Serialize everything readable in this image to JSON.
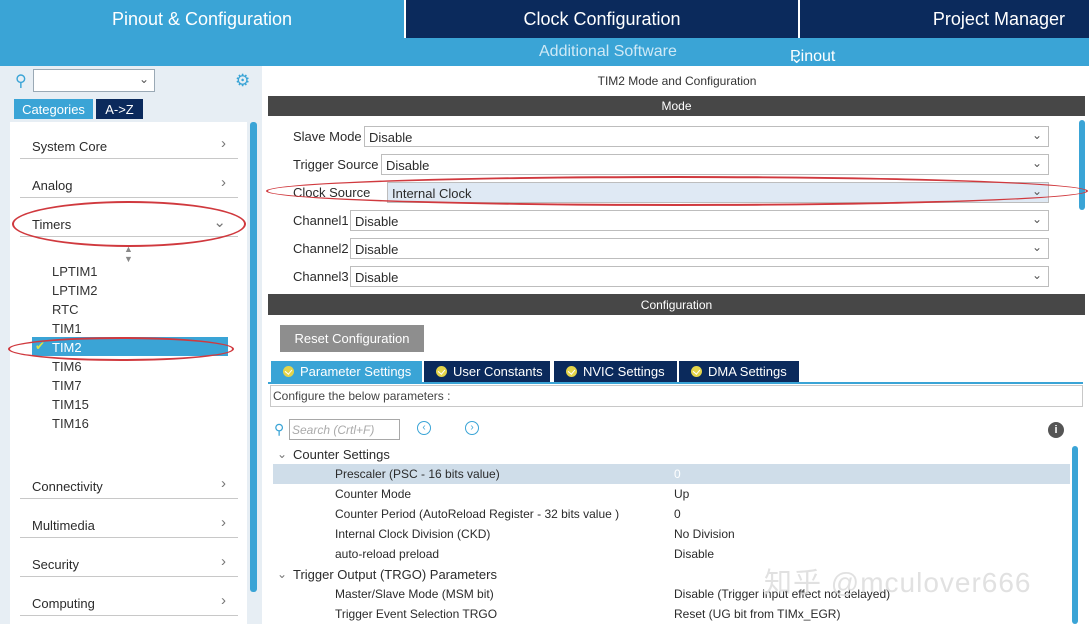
{
  "top_tabs": {
    "pinout": "Pinout & Configuration",
    "clock": "Clock Configuration",
    "project": "Project Manager"
  },
  "sub_bar": {
    "additional": "Additional Software",
    "pinout": "Pinout"
  },
  "left": {
    "tabs": [
      "Categories",
      "A->Z"
    ],
    "categories": [
      "System Core",
      "Analog",
      "Timers",
      "Connectivity",
      "Multimedia",
      "Security",
      "Computing"
    ],
    "timers": [
      "LPTIM1",
      "LPTIM2",
      "RTC",
      "TIM1",
      "TIM2",
      "TIM6",
      "TIM7",
      "TIM15",
      "TIM16"
    ],
    "selected_timer": "TIM2"
  },
  "right": {
    "title": "TIM2 Mode and Configuration",
    "mode_bar": "Mode",
    "mode_rows": [
      {
        "label": "Slave Mode",
        "value": "Disable"
      },
      {
        "label": "Trigger Source",
        "value": "Disable"
      },
      {
        "label": "Clock Source",
        "value": "Internal Clock"
      },
      {
        "label": "Channel1",
        "value": "Disable"
      },
      {
        "label": "Channel2",
        "value": "Disable"
      },
      {
        "label": "Channel3",
        "value": "Disable"
      }
    ],
    "config_bar": "Configuration",
    "reset_button": "Reset Configuration",
    "param_tabs": [
      "Parameter Settings",
      "User Constants",
      "NVIC Settings",
      "DMA Settings"
    ],
    "hint": "Configure the below parameters :",
    "search_placeholder": "Search (Crtl+F)",
    "groups": {
      "counter": "Counter Settings",
      "trgo": "Trigger Output (TRGO) Parameters"
    },
    "params": [
      {
        "key": "Prescaler (PSC - 16 bits value)",
        "value": "0"
      },
      {
        "key": "Counter Mode",
        "value": "Up"
      },
      {
        "key": "Counter Period (AutoReload Register - 32 bits value )",
        "value": "0"
      },
      {
        "key": "Internal Clock Division (CKD)",
        "value": "No Division"
      },
      {
        "key": "auto-reload preload",
        "value": "Disable"
      },
      {
        "key": "Master/Slave Mode (MSM bit)",
        "value": "Disable (Trigger input effect not delayed)"
      },
      {
        "key": "Trigger Event Selection TRGO",
        "value": "Reset (UG bit from TIMx_EGR)"
      }
    ]
  },
  "watermark": "知乎 @mculover666",
  "colors": {
    "accent": "#3aa4d6",
    "navy": "#0b2a5c",
    "highlight": "#d0393e"
  }
}
